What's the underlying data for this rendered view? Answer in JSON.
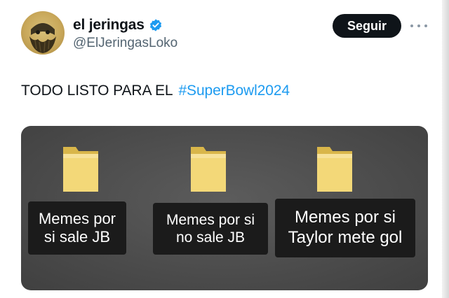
{
  "author": {
    "display_name": "el jeringas",
    "handle": "@ElJeringasLoko",
    "verified": true,
    "verified_color": "#1d9bf0"
  },
  "actions": {
    "follow_label": "Seguir",
    "more_icon": "more-horizontal-icon"
  },
  "tweet": {
    "text": "TODO LISTO PARA EL",
    "hashtag": "#SuperBowl2024",
    "hashtag_color": "#1d9bf0"
  },
  "media": {
    "folders": [
      {
        "icon": "folder-icon",
        "label": "Memes por\nsi sale JB"
      },
      {
        "icon": "folder-icon",
        "label": "Memes por si\nno sale JB"
      },
      {
        "icon": "folder-icon",
        "label": "Memes por si\nTaylor mete gol"
      }
    ]
  }
}
